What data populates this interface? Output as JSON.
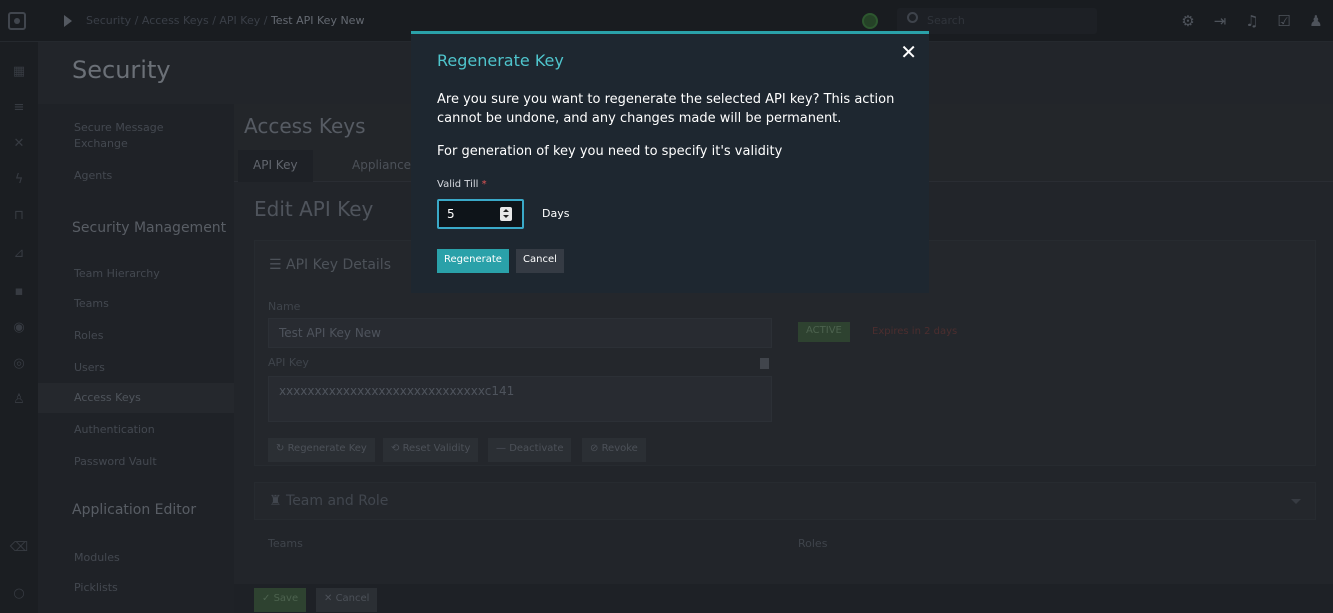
{
  "topbar": {
    "breadcrumb_path": "Security / Access Keys / API Key /",
    "breadcrumb_current": "Test API Key New",
    "search_placeholder": "Search",
    "icons": [
      "gear-icon",
      "move-icon",
      "bell-icon",
      "clipboard-icon",
      "user-icon"
    ]
  },
  "sidebar": {
    "title": "Security",
    "items": [
      {
        "label": "Secure Message Exchange"
      },
      {
        "label": "Agents"
      }
    ],
    "section_management": "Security Management",
    "management_items": [
      {
        "label": "Team Hierarchy"
      },
      {
        "label": "Teams"
      },
      {
        "label": "Roles"
      },
      {
        "label": "Users"
      },
      {
        "label": "Access Keys",
        "active": true
      },
      {
        "label": "Authentication"
      },
      {
        "label": "Password Vault"
      }
    ],
    "section_editor": "Application Editor",
    "editor_items": [
      {
        "label": "Modules"
      },
      {
        "label": "Picklists"
      }
    ]
  },
  "main": {
    "title": "Access Keys",
    "tabs": [
      {
        "label": "API Key",
        "active": true
      },
      {
        "label": "Appliance"
      }
    ],
    "edit_title": "Edit API Key",
    "details_header": "API Key Details",
    "name_label": "Name",
    "name_value": "Test API Key New",
    "status_badge": "ACTIVE",
    "expires": "Expires in 2 days",
    "api_key_label": "API Key",
    "api_key_value": "xxxxxxxxxxxxxxxxxxxxxxxxxxxxxc141",
    "actions": [
      {
        "label": "Regenerate Key"
      },
      {
        "label": "Reset Validity"
      },
      {
        "label": "Deactivate"
      },
      {
        "label": "Revoke"
      }
    ],
    "team_role_header": "Team and Role",
    "teams_label": "Teams",
    "roles_label": "Roles",
    "save_label": "Save",
    "cancel_label": "Cancel"
  },
  "modal": {
    "title": "Regenerate Key",
    "message": "Are you sure you want to regenerate the selected API key? This action cannot be undone, and any changes made will be permanent.",
    "message2": "For generation of key you need to specify it's validity",
    "valid_till_label": "Valid Till",
    "valid_till_value": "5",
    "unit": "Days",
    "regenerate_label": "Regenerate",
    "cancel_label": "Cancel"
  },
  "colors": {
    "accent": "#2aa1a9",
    "modal_title": "#4fc5cd",
    "modal_bg": "#1e2730",
    "required": "#e05555"
  }
}
